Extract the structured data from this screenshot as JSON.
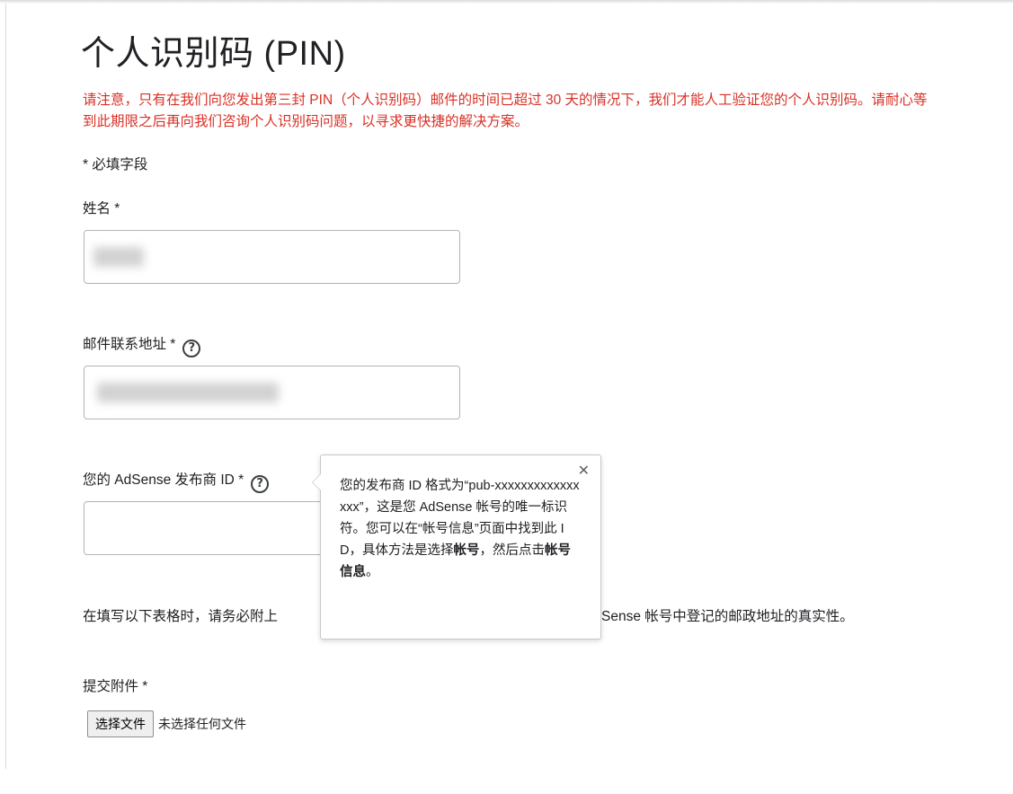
{
  "page": {
    "title": "个人识别码 (PIN)",
    "notice": "请注意，只有在我们向您发出第三封 PIN（个人识别码）邮件的时间已超过 30 天的情况下，我们才能人工验证您的个人识别码。请耐心等到此期限之后再向我们咨询个人识别码问题，以寻求更快捷的解决方案。",
    "required_note": "* 必填字段"
  },
  "form": {
    "name_label": "姓名 *",
    "email_label": "邮件联系地址 *",
    "publisher_id_label": "您的 AdSense 发布商 ID *",
    "instruction_left": "在填写以下表格时，请务必附上",
    "instruction_right": "Sense 帐号中登记的邮政地址的真实性。",
    "attachment_label": "提交附件 *",
    "file_button_label": "选择文件",
    "file_status": "未选择任何文件"
  },
  "tooltip": {
    "text_part1": "您的发布商 ID 格式为“pub-xxxxxxxxxxxxxxxx”，这是您 AdSense 帐号的唯一标识符。您可以在“帐号信息”页面中找到此 ID，具体方法是选择",
    "bold1": "帐号",
    "text_part2": "，然后点击",
    "bold2": "帐号信息",
    "text_part3": "。"
  },
  "icons": {
    "help": "help-circle-icon",
    "close": "close-icon"
  },
  "colors": {
    "notice_red": "#d93025",
    "text": "#202124"
  }
}
